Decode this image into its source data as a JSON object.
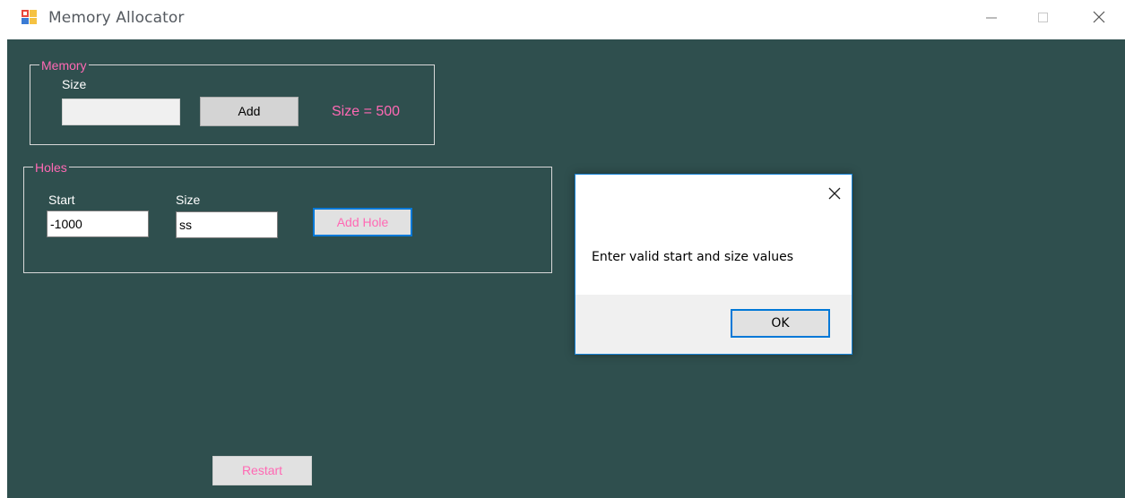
{
  "window": {
    "title": "Memory Allocator",
    "icons": {
      "app": "app-icon",
      "minimize": "minimize-icon",
      "maximize": "maximize-icon",
      "close": "close-icon"
    }
  },
  "memory_group": {
    "legend": "Memory",
    "size_label": "Size",
    "size_input_value": "",
    "add_button_label": "Add",
    "size_display": "Size = 500"
  },
  "holes_group": {
    "legend": "Holes",
    "start_label": "Start",
    "size_label": "Size",
    "start_input_value": "-1000",
    "size_input_value": "ss",
    "add_hole_button_label": "Add Hole"
  },
  "restart_button_label": "Restart",
  "dialog": {
    "message": "Enter valid start and size values",
    "ok_label": "OK",
    "close_icon": "close-icon"
  },
  "colors": {
    "background": "#2f4f4e",
    "accent_pink": "#ff69b4",
    "focus_blue": "#0078d7"
  }
}
